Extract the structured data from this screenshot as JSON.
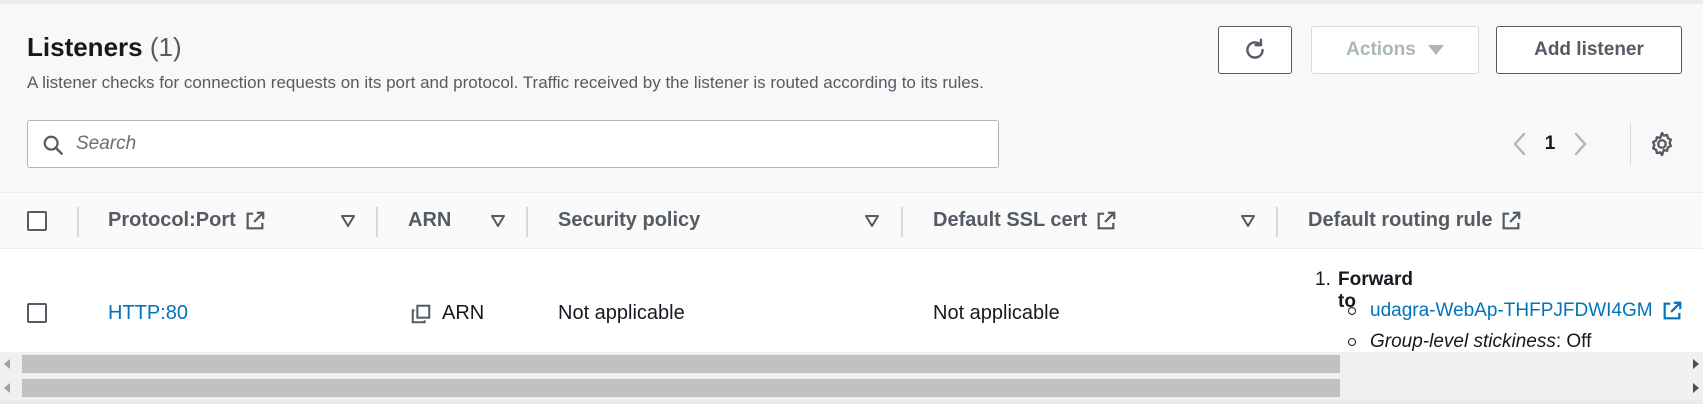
{
  "header": {
    "title": "Listeners",
    "count": "(1)",
    "description": "A listener checks for connection requests on its port and protocol. Traffic received by the listener is routed according to its rules."
  },
  "toolbar": {
    "refresh_icon": "refresh-icon",
    "actions_label": "Actions",
    "add_listener_label": "Add listener"
  },
  "search": {
    "placeholder": "Search",
    "value": ""
  },
  "pagination": {
    "current_page": "1"
  },
  "table": {
    "columns": [
      {
        "label": "Protocol:Port",
        "external_link": true
      },
      {
        "label": "ARN",
        "external_link": false
      },
      {
        "label": "Security policy",
        "external_link": false
      },
      {
        "label": "Default SSL cert",
        "external_link": true
      },
      {
        "label": "Default routing rule",
        "external_link": true
      }
    ],
    "rows": [
      {
        "protocol_port": "HTTP:80",
        "arn": "ARN",
        "security_policy": "Not applicable",
        "default_ssl_cert": "Not applicable",
        "routing_rule": {
          "number": "1.",
          "action": "Forward to",
          "target_group": "udagra-WebAp-THFPJFDWI4GM",
          "stickiness_label": "Group-level stickiness",
          "stickiness_value": ": Off"
        }
      }
    ]
  },
  "colors": {
    "link": "#0073bb",
    "text": "#16191f",
    "secondary_text": "#545b64",
    "disabled_text": "#aab7b8",
    "header_bg": "#f8f8f8"
  }
}
